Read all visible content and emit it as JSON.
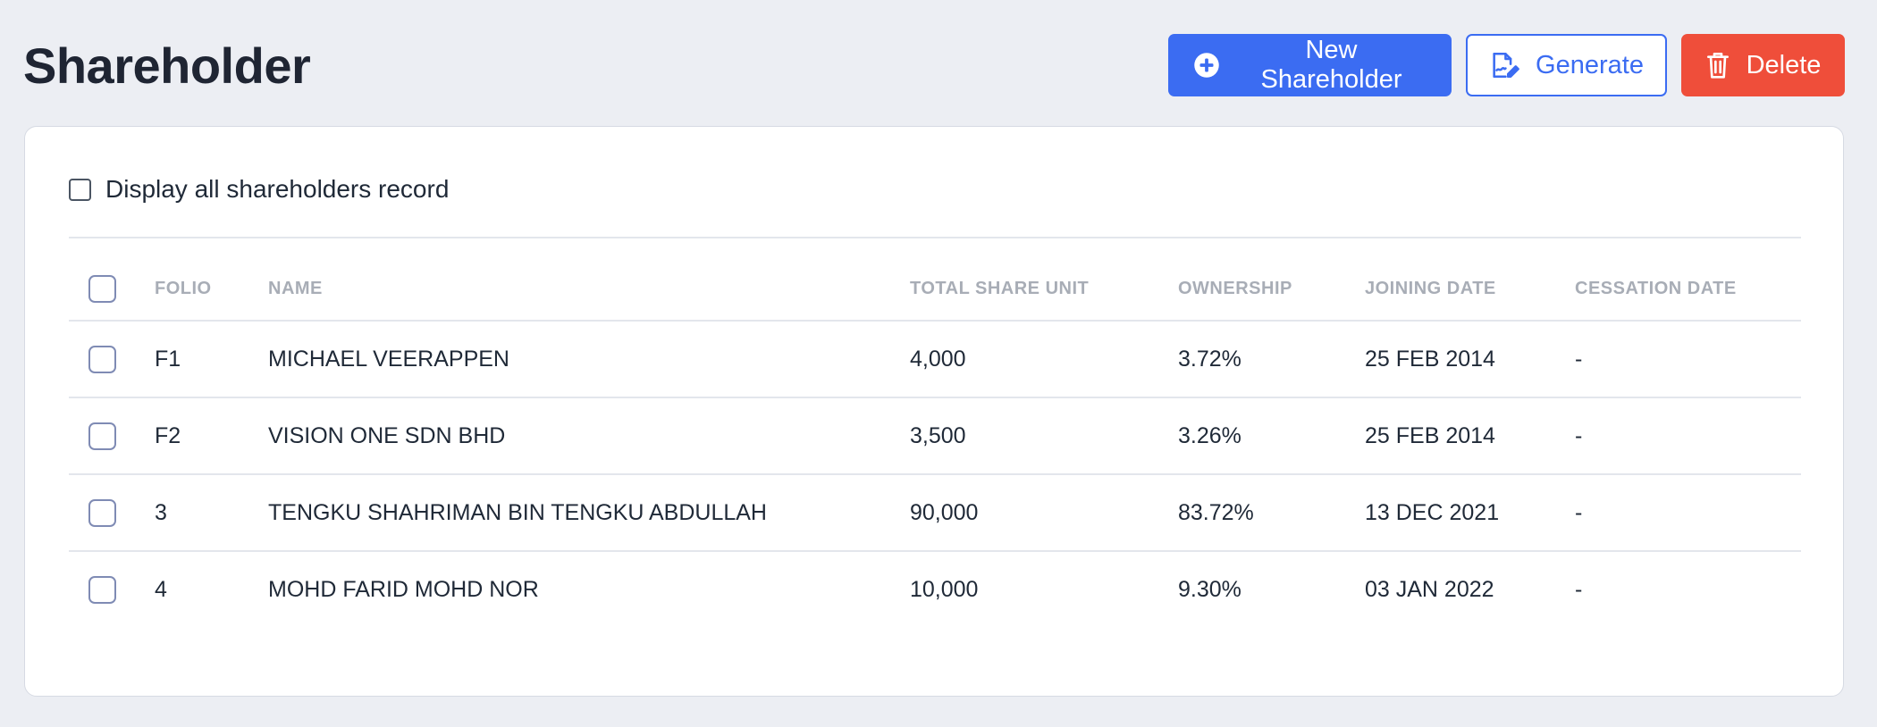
{
  "page": {
    "title": "Shareholder"
  },
  "toolbar": {
    "new_label": "New Shareholder",
    "generate_label": "Generate",
    "delete_label": "Delete"
  },
  "filter": {
    "display_all_label": "Display all shareholders record",
    "display_all_checked": false
  },
  "table": {
    "columns": {
      "folio": "FOLIO",
      "name": "NAME",
      "total_share_unit": "TOTAL SHARE UNIT",
      "ownership": "OWNERSHIP",
      "joining_date": "JOINING DATE",
      "cessation_date": "CESSATION DATE"
    },
    "rows": [
      {
        "folio": "F1",
        "name": "MICHAEL VEERAPPEN",
        "total_share_unit": "4,000",
        "ownership": "3.72%",
        "joining_date": "25 FEB 2014",
        "cessation_date": "-"
      },
      {
        "folio": "F2",
        "name": "VISION ONE SDN BHD",
        "total_share_unit": "3,500",
        "ownership": "3.26%",
        "joining_date": "25 FEB 2014",
        "cessation_date": "-"
      },
      {
        "folio": "3",
        "name": "TENGKU SHAHRIMAN BIN TENGKU ABDULLAH",
        "total_share_unit": "90,000",
        "ownership": "83.72%",
        "joining_date": "13 DEC 2021",
        "cessation_date": "-"
      },
      {
        "folio": "4",
        "name": "MOHD FARID MOHD NOR",
        "total_share_unit": "10,000",
        "ownership": "9.30%",
        "joining_date": "03 JAN 2022",
        "cessation_date": "-"
      }
    ]
  },
  "icons": {
    "new": "plus-circle-icon",
    "generate": "document-edit-icon",
    "delete": "trash-icon"
  },
  "colors": {
    "primary": "#3b6cf2",
    "danger": "#ef4e3a",
    "background": "#eceef3"
  }
}
